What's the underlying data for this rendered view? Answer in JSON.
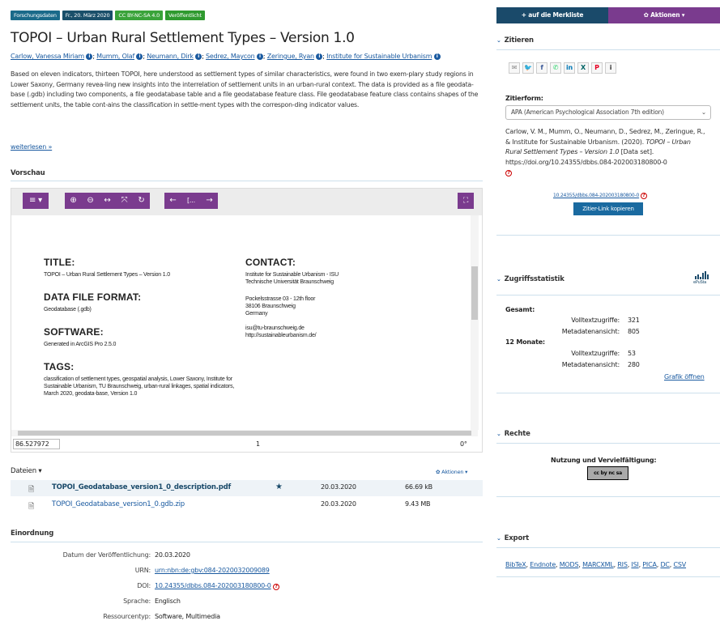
{
  "badges": [
    {
      "label": "Forschungsdaten",
      "color": "#1a6a8a"
    },
    {
      "label": "Fr., 20. März 2020",
      "color": "#1a4f6a"
    },
    {
      "label": "CC BY-NC-SA 4.0",
      "color": "#3aa33a"
    },
    {
      "label": "Veröffentlicht",
      "color": "#2f9a2f"
    }
  ],
  "title": "TOPOI – Urban Rural Settlement Types – Version 1.0",
  "authors": [
    "Carlow, Vanessa Miriam",
    "Mumm, Olaf",
    "Neumann, Dirk",
    "Sedrez, Maycon",
    "Zeringue, Ryan",
    "Institute for Sustainable Urbanism"
  ],
  "abstract": "Based on eleven indicators, thirteen TOPOI, here understood as settlement types of similar characteristics, were found in two exem-plary study regions in Lower Saxony, Germany revea-ling new insights into the interrelation of settlement units in an urban-rural context. The data is provided as a file geodata-base (.gdb) including two components, a file geodatabase table and a file geodatabase feature class. File geodatabase feature class contains shapes of the settlement units, the table cont-ains the classification in settle-ment types with the correspon-ding indicator values.",
  "read_more": "weiterlesen »",
  "preview": {
    "heading": "Vorschau",
    "page_input": "1",
    "coord": "86.527972",
    "page_num": "1",
    "rotation": "0°",
    "toolbar_page": "[...",
    "doc": {
      "title_h": "TITLE:",
      "title_v": "TOPOI – Urban Rural Settlement Types – Version 1.0",
      "format_h": "DATA FILE FORMAT:",
      "format_v": "Geodatabase (.gdb)",
      "software_h": "SOFTWARE:",
      "software_v": "Generated in ArcGIS Pro 2.5.0",
      "tags_h": "TAGS:",
      "tags_v": "classification of settlement types, geospatial analysis, Lower Saxony, Institute for Sustainable Urbanism, TU Braunschweig, urban-rural linkages, spatial indicators, March 2020, geodata-base, Version 1.0",
      "contact_h": "CONTACT:",
      "contact_l1": "Institute for Sustainable Urbanism - ISU",
      "contact_l2": "Technische Universität Braunschweig",
      "addr_l1": "Pockelsstrasse 03 - 12th floor",
      "addr_l2": "38106 Braunschweig",
      "addr_l3": "Germany",
      "mail": "isu@tu-braunschweig.de",
      "web": "http://sustainableurbanism.de/"
    }
  },
  "files": {
    "heading": "Dateien ▾",
    "actions": "✿ Aktionen ▾",
    "rows": [
      {
        "name": "TOPOI_Geodatabase_version1_0_description.pdf",
        "date": "20.03.2020",
        "size": "66.69 kB"
      },
      {
        "name": "TOPOI_Geodatabase_version1_0.gdb.zip",
        "date": "20.03.2020",
        "size": "9.43 MB"
      }
    ]
  },
  "meta": {
    "heading": "Einordnung",
    "rows": [
      {
        "k": "Datum der Veröffentlichung:",
        "v": "20.03.2020"
      },
      {
        "k": "URN:",
        "v": "urn:nbn:de:gbv:084-2020032009089"
      },
      {
        "k": "DOI:",
        "v": "10.24355/dbbs.084-202003180800-0"
      },
      {
        "k": "Sprache:",
        "v": "Englisch"
      },
      {
        "k": "Ressourcentyp:",
        "v": "Software, Multimedia"
      }
    ]
  },
  "side": {
    "merkliste": "+ auf die Merkliste",
    "aktionen": "✿ Aktionen ▾",
    "zitieren": "Zitieren",
    "zitierform": "Zitierform:",
    "zitierform_sel": "APA (American Psychological Association 7th edition)",
    "citation_1": "Carlow, V. M., Mumm, O., Neumann, D., Sedrez, M., Zeringue, R., & Institute for Sustainable Urbanism. (2020).",
    "citation_title": "TOPOI – Urban Rural Settlement Types – Version 1.0",
    "citation_2": "[Data set]. https://doi.org/10.24355/dbbs.084-202003180800-0",
    "doi_link": "10.24355/dbbs.084-202003180800-0",
    "copy_btn": "Zitier-Link kopieren",
    "stats": "Zugriffsstatistik",
    "epusta": "ePuSta",
    "gesamt": "Gesamt:",
    "volltext": "Volltextzugriffe:",
    "metaansicht": "Metadatenansicht:",
    "v_gesamt_volltext": "321",
    "v_gesamt_meta": "805",
    "zwoelf": "12 Monate:",
    "v_12_volltext": "53",
    "v_12_meta": "280",
    "grafik": "Grafik öffnen",
    "rechte": "Rechte",
    "nutzung": "Nutzung und Vervielfältigung:",
    "cc": "cc by nc sa",
    "export": "Export",
    "export_links": [
      "BibTeX",
      "Endnote",
      "MODS",
      "MARCXML",
      "RIS",
      "ISI",
      "PICA",
      "DC",
      "CSV"
    ]
  },
  "colors": {
    "accent": "#7a3b8e",
    "navy": "#1a4a6a",
    "link": "#1a5aa0",
    "btn": "#1a6aa0"
  }
}
